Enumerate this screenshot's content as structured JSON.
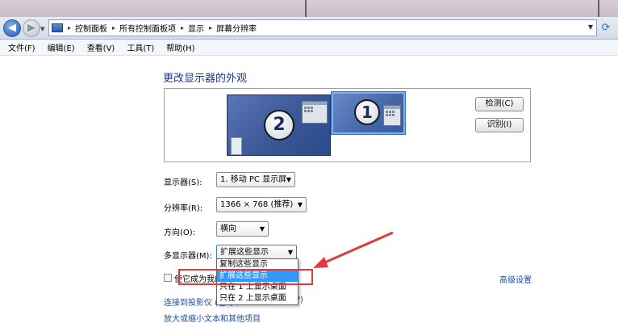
{
  "navigation": {
    "breadcrumbs": [
      "控制面板",
      "所有控制面板项",
      "显示",
      "屏幕分辨率"
    ]
  },
  "menu": {
    "items": [
      "文件(F)",
      "编辑(E)",
      "查看(V)",
      "工具(T)",
      "帮助(H)"
    ]
  },
  "page": {
    "title": "更改显示器的外观"
  },
  "monitors": {
    "display_2_number": "2",
    "display_1_number": "1",
    "detect_button": "检测(C)",
    "identify_button": "识别(I)"
  },
  "form": {
    "display_label": "显示器(S):",
    "display_value": "1. 移动 PC 显示屏",
    "resolution_label": "分辨率(R):",
    "resolution_value": "1366 × 768 (推荐)",
    "orientation_label": "方向(O):",
    "orientation_value": "横向",
    "multi_display_label": "多显示器(M):",
    "multi_display_value": "扩展这些显示",
    "multi_display_options": [
      "复制这些显示",
      "扩展这些显示",
      "只在 1 上显示桌面",
      "只在 2 上显示桌面"
    ],
    "make_main_label": "使它成为我的主显示器",
    "advanced_link": "高级设置"
  },
  "links": {
    "projector": "连接到投影仪 (也可以按 Windows 徽标键 + P)",
    "projector_tail": "P)",
    "text_size": "放大或缩小文本和其他项目"
  },
  "colors": {
    "title_color": "#1e3287",
    "link_color": "#1a4fa0",
    "highlight_annotation": "#e03a3a",
    "selected_option": "#3399ff"
  }
}
